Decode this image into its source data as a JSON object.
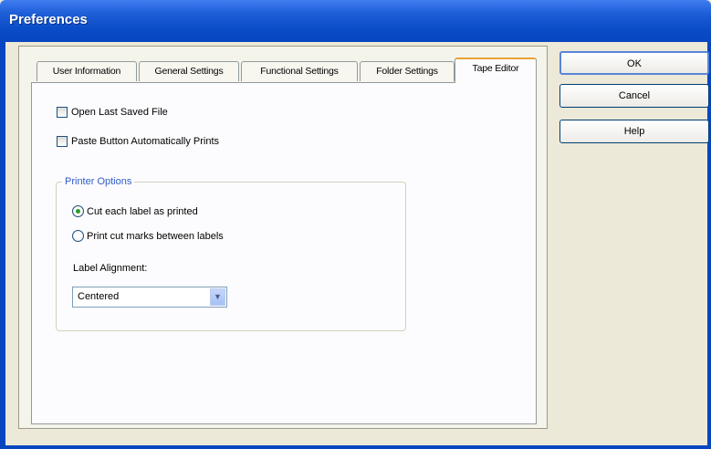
{
  "window": {
    "title": "Preferences"
  },
  "tabs": [
    {
      "label": "User Information",
      "active": false
    },
    {
      "label": "General Settings",
      "active": false
    },
    {
      "label": "Functional Settings",
      "active": false
    },
    {
      "label": "Folder Settings",
      "active": false
    },
    {
      "label": "Tape Editor",
      "active": true
    }
  ],
  "options": {
    "open_last_saved": {
      "label": "Open Last Saved File",
      "checked": false
    },
    "paste_prints": {
      "label": "Paste Button Automatically Prints",
      "checked": false
    }
  },
  "printer_options": {
    "title": "Printer Options",
    "radio_cut": {
      "label": "Cut each label as printed",
      "selected": true
    },
    "radio_marks": {
      "label": "Print cut marks between labels",
      "selected": false
    },
    "alignment_label": "Label Alignment:",
    "alignment_value": "Centered"
  },
  "buttons": {
    "ok": "OK",
    "cancel": "Cancel",
    "help": "Help"
  }
}
